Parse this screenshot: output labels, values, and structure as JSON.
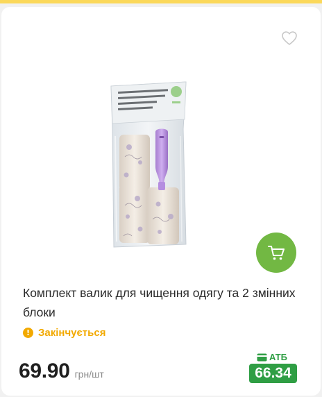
{
  "product": {
    "title": "Комплект валик для чищення одягу та 2 змінних блоки",
    "status": "Закінчується",
    "price": "69.90",
    "price_unit": "грн/шт",
    "promo_label": "АТБ",
    "promo_price": "66.34",
    "package_label": "Комплект: валик для чищення одягу та 2 змінних блоки"
  },
  "icons": {
    "favorite": "heart-outline-icon",
    "cart": "shopping-cart-icon",
    "status": "exclamation-circle-icon",
    "promo": "card-icon"
  },
  "colors": {
    "accent_green": "#72b843",
    "promo_green": "#2f9e44",
    "warning_orange": "#f2a900",
    "top_strip": "#fbd85a"
  }
}
